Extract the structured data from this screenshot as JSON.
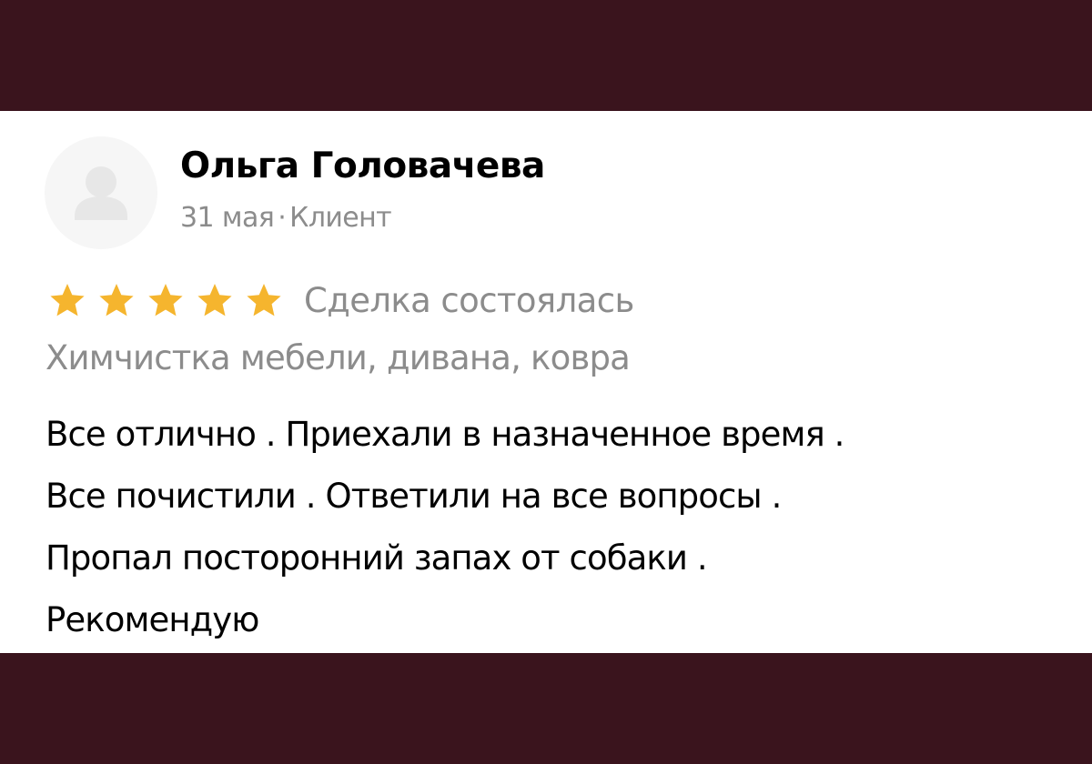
{
  "review": {
    "author": {
      "name": "Ольга Головачева",
      "avatar_icon": "user-silhouette-icon"
    },
    "meta": {
      "date": "31 мая",
      "separator": "·",
      "role": "Клиент"
    },
    "rating": {
      "value": 5,
      "max": 5,
      "star_icon": "star-icon",
      "star_color": "#f5b52e",
      "deal_status": "Сделка состоялась"
    },
    "service": "Химчистка мебели, дивана, ковра",
    "text_lines": [
      "Все отлично . Приехали в назначенное время .",
      "Все почистили . Ответили на все вопросы .",
      "Пропал посторонний запах от собаки .",
      "Рекомендую"
    ]
  },
  "colors": {
    "background": "#3a141d",
    "card": "#ffffff",
    "muted_text": "#8c8c8c",
    "primary_text": "#000000"
  }
}
